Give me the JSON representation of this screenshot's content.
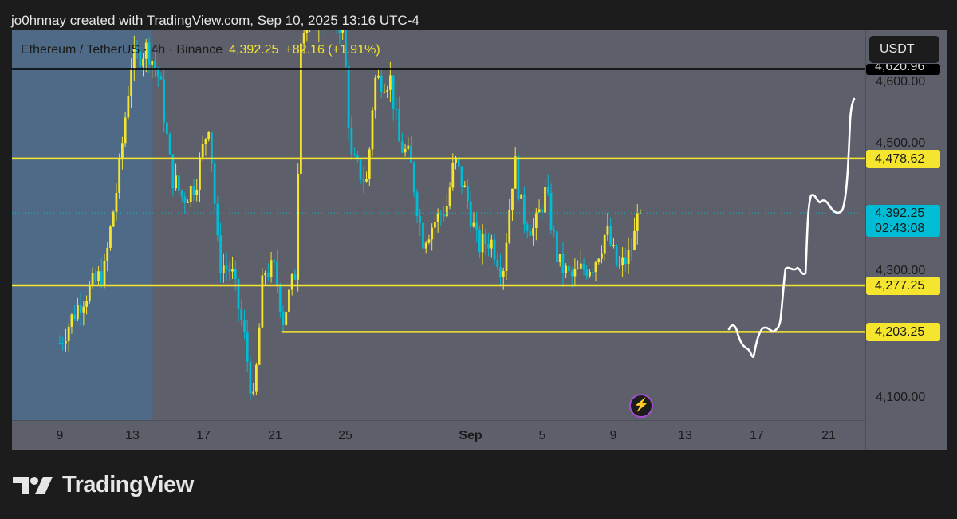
{
  "header": {
    "credit": "jo0hnnay created with TradingView.com, Sep 10, 2025 13:16 UTC-4"
  },
  "legend": {
    "symbol": "Ethereum / TetherUS · 4h · Binance",
    "price": "4,392.25",
    "change": "+82.16 (+1.91%)"
  },
  "price_axis": {
    "currency": "USDT",
    "ticks": [
      "4,600.00",
      "4,500.00",
      "4,300.00",
      "4,100.00"
    ],
    "tags": {
      "high": "4,620.96",
      "resistance": "4,478.62",
      "last": "4,392.25",
      "countdown": "02:43:08",
      "support1": "4,277.25",
      "support2": "4,203.25"
    }
  },
  "time_axis": {
    "labels": [
      "9",
      "13",
      "17",
      "21",
      "25",
      "Sep",
      "5",
      "9",
      "13",
      "17",
      "21"
    ]
  },
  "footer": {
    "logo": "TradingView"
  },
  "colors": {
    "up": "#f5e52e",
    "down": "#00bcd4",
    "level": "#f5e52e",
    "chart_bg": "#5d5f6a",
    "highlight": "#4e6a86"
  },
  "chart_data": {
    "type": "candlestick",
    "timeframe": "4h",
    "x_unit": "days since Aug 9, 2025",
    "ylim": [
      4060,
      4720
    ],
    "yticks": [
      4100,
      4300,
      4500,
      4600
    ],
    "levels": [
      {
        "name": "high",
        "price": 4620.96,
        "color": "#000000"
      },
      {
        "name": "resistance",
        "price": 4478.62,
        "color": "#f5e52e"
      },
      {
        "name": "support1",
        "price": 4277.25,
        "color": "#f5e52e"
      },
      {
        "name": "support2",
        "price": 4203.25,
        "color": "#f5e52e",
        "from_day": 12.4
      }
    ],
    "last_price": 4392.25,
    "highlight_range_days": [
      -2.7,
      5.2
    ],
    "close_path": [
      [
        0,
        4186
      ],
      [
        1.1,
        4250
      ],
      [
        2.5,
        4301
      ],
      [
        3.3,
        4453
      ],
      [
        4.0,
        4630
      ],
      [
        4.9,
        4655
      ],
      [
        5.6,
        4604
      ],
      [
        6.25,
        4453
      ],
      [
        6.9,
        4415
      ],
      [
        7.6,
        4440
      ],
      [
        8.35,
        4540
      ],
      [
        8.9,
        4313
      ],
      [
        9.6,
        4301
      ],
      [
        10.3,
        4200
      ],
      [
        10.85,
        4085
      ],
      [
        11.4,
        4301
      ],
      [
        12.05,
        4301
      ],
      [
        12.5,
        4224
      ],
      [
        13.2,
        4301
      ],
      [
        13.5,
        4680
      ],
      [
        14.5,
        4705
      ],
      [
        15.85,
        4692
      ],
      [
        16.3,
        4477
      ],
      [
        17.2,
        4440
      ],
      [
        17.6,
        4604
      ],
      [
        18.5,
        4604
      ],
      [
        19.0,
        4503
      ],
      [
        19.6,
        4477
      ],
      [
        20.3,
        4351
      ],
      [
        20.95,
        4377
      ],
      [
        21.65,
        4402
      ],
      [
        22.1,
        4477
      ],
      [
        22.8,
        4415
      ],
      [
        23.4,
        4339
      ],
      [
        24.1,
        4351
      ],
      [
        24.8,
        4301
      ],
      [
        25.45,
        4477
      ],
      [
        25.9,
        4389
      ],
      [
        26.55,
        4364
      ],
      [
        27.2,
        4427
      ],
      [
        27.9,
        4313
      ],
      [
        28.6,
        4288
      ],
      [
        29.2,
        4301
      ],
      [
        29.9,
        4313
      ],
      [
        30.6,
        4364
      ],
      [
        31.25,
        4301
      ],
      [
        31.9,
        4326
      ],
      [
        32.5,
        4392
      ]
    ]
  }
}
